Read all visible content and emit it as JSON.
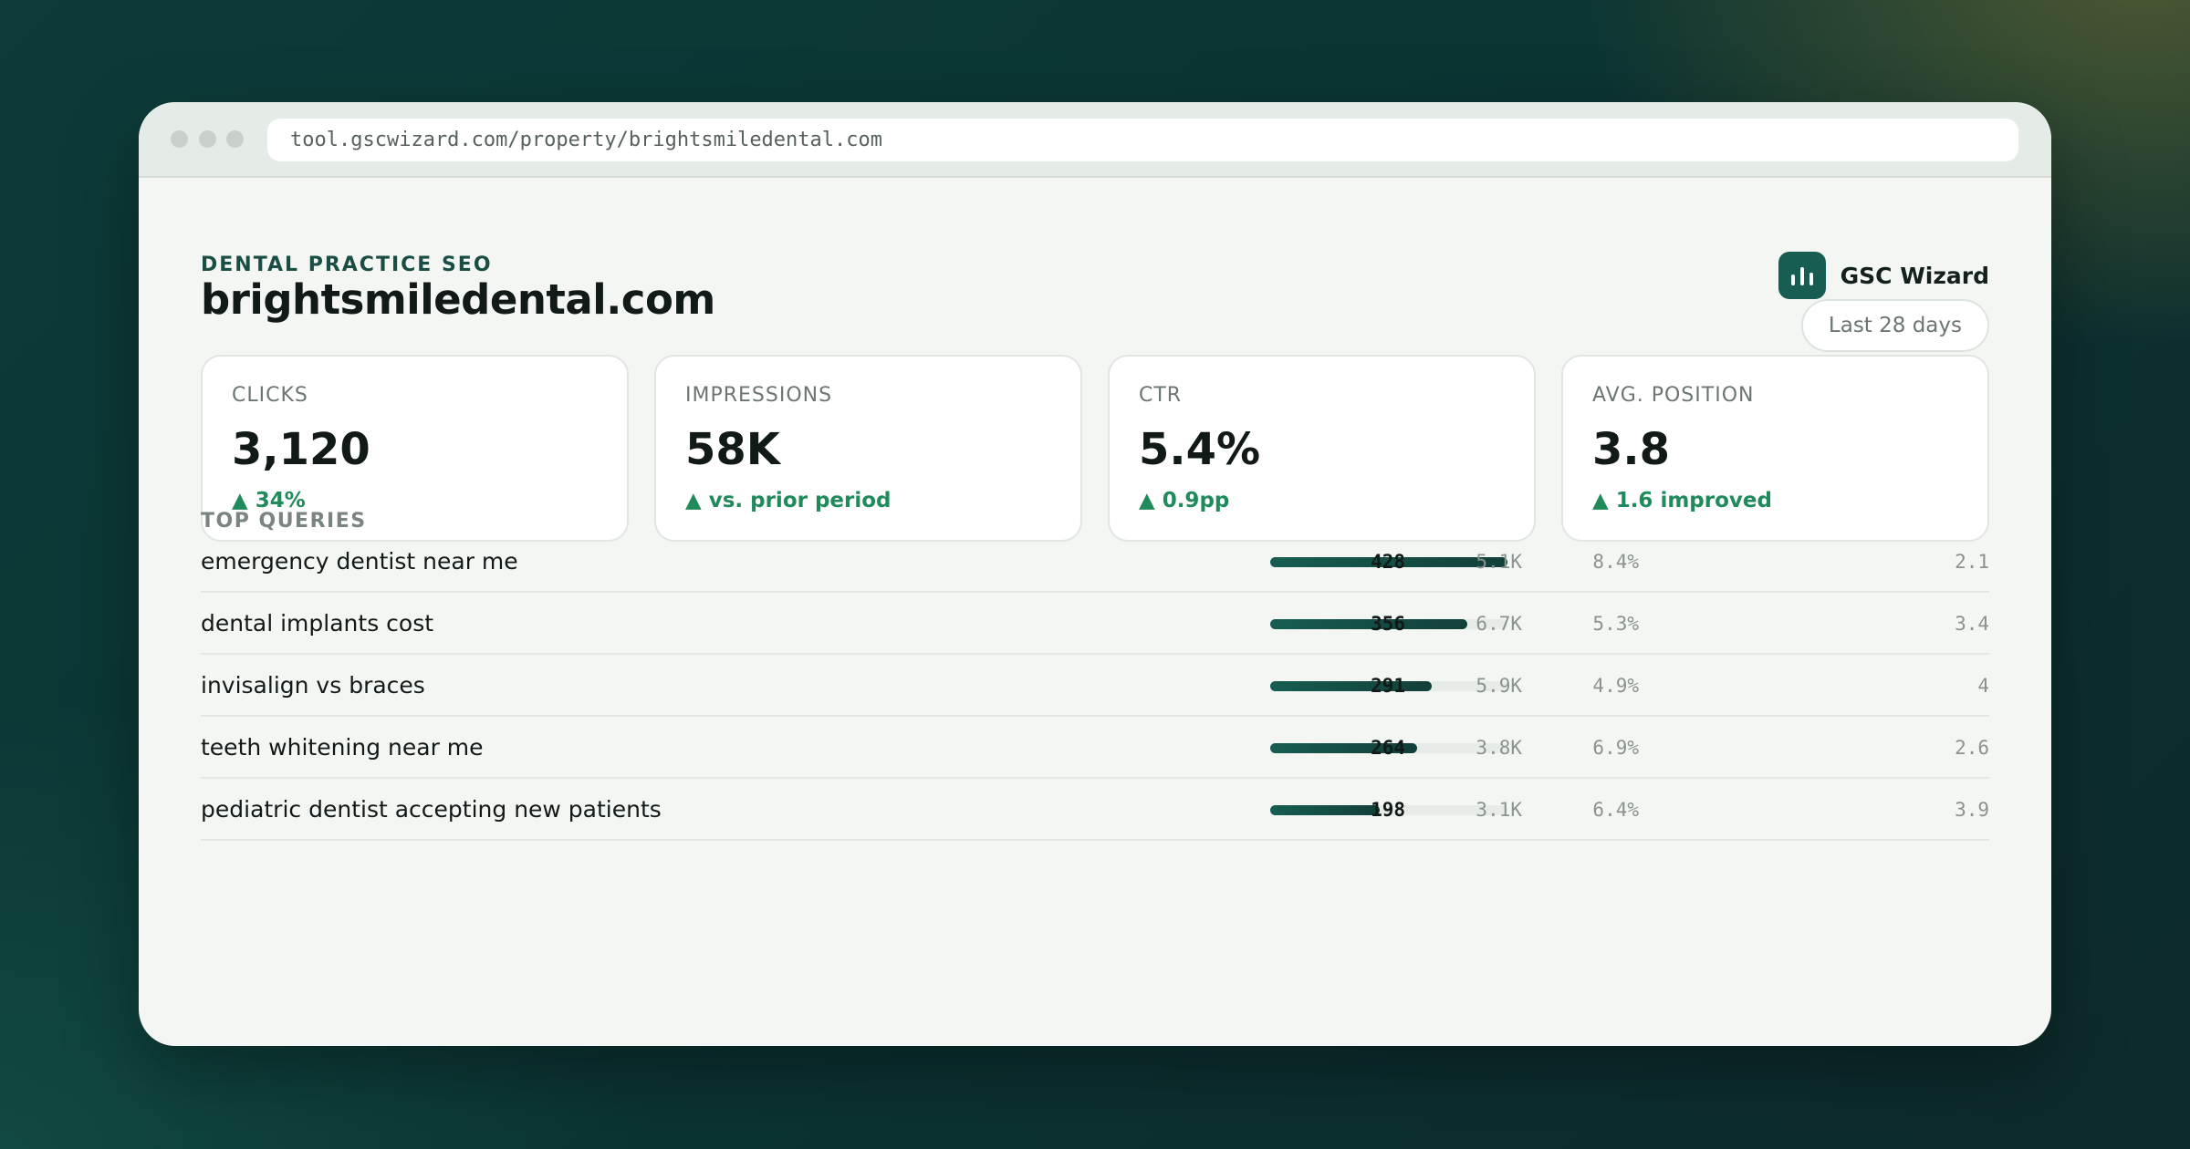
{
  "browser": {
    "url": "tool.gscwizard.com/property/brightsmiledental.com"
  },
  "header": {
    "eyebrow": "DENTAL PRACTICE SEO",
    "title": "brightsmiledental.com",
    "brand_name": "GSC Wizard",
    "brand_icon": "bar-chart-icon",
    "date_range": "Last 28 days"
  },
  "kpis": [
    {
      "label": "CLICKS",
      "value": "3,120",
      "delta": "▲ 34%"
    },
    {
      "label": "IMPRESSIONS",
      "value": "58K",
      "delta": "▲ vs. prior period"
    },
    {
      "label": "CTR",
      "value": "5.4%",
      "delta": "▲ 0.9pp"
    },
    {
      "label": "AVG. POSITION",
      "value": "3.8",
      "delta": "▲ 1.6 improved"
    }
  ],
  "queries": {
    "title": "TOP QUERIES",
    "rows": [
      {
        "query": "emergency dentist near me",
        "share": 1.0,
        "clicks": "428",
        "impressions": "5.1K",
        "ctr": "8.4%",
        "position": "2.1"
      },
      {
        "query": "dental implants cost",
        "share": 0.83,
        "clicks": "356",
        "impressions": "6.7K",
        "ctr": "5.3%",
        "position": "3.4"
      },
      {
        "query": "invisalign vs braces",
        "share": 0.68,
        "clicks": "291",
        "impressions": "5.9K",
        "ctr": "4.9%",
        "position": "4"
      },
      {
        "query": "teeth whitening near me",
        "share": 0.62,
        "clicks": "264",
        "impressions": "3.8K",
        "ctr": "6.9%",
        "position": "2.6"
      },
      {
        "query": "pediatric dentist accepting new patients",
        "share": 0.46,
        "clicks": "198",
        "impressions": "3.1K",
        "ctr": "6.4%",
        "position": "3.9"
      }
    ]
  },
  "colors": {
    "accent": "#175d52",
    "positive": "#1f8a5a",
    "bar_track": "#e7ece8"
  }
}
